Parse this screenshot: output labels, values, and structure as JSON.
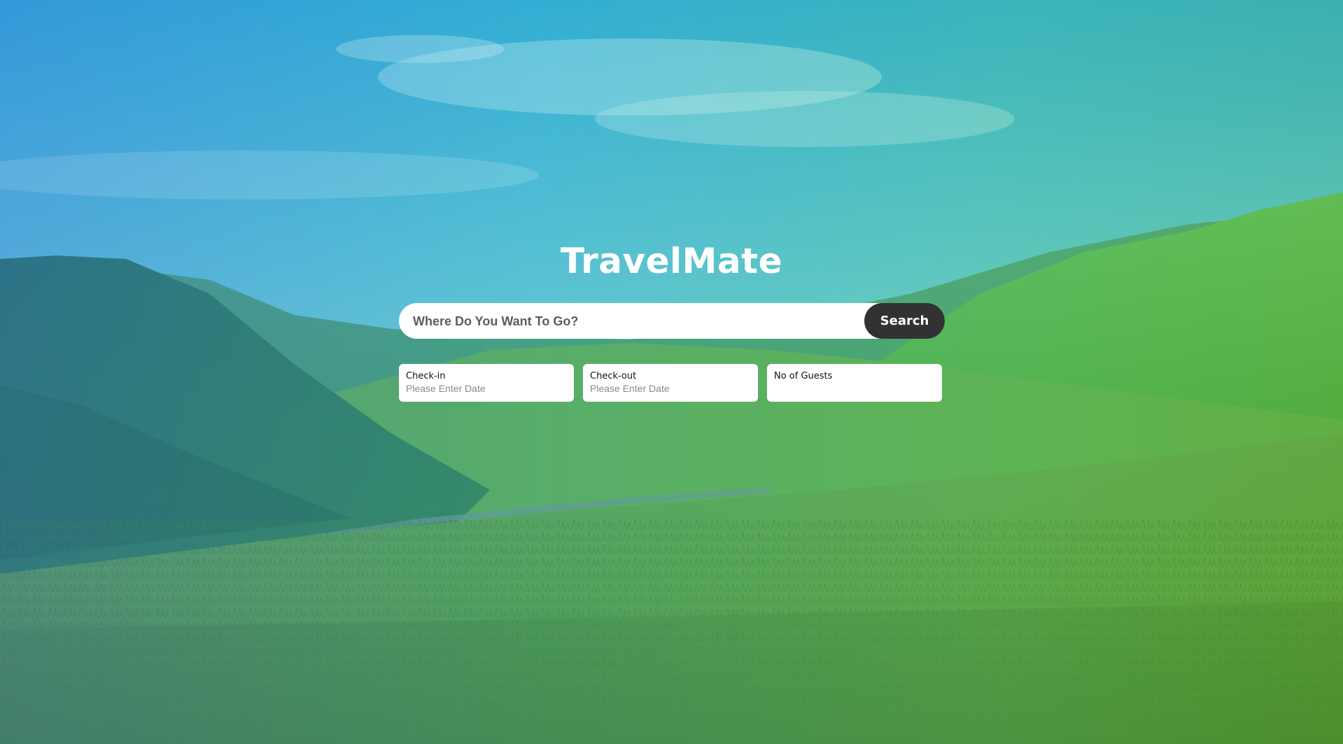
{
  "brand": {
    "title": "TravelMate"
  },
  "search": {
    "placeholder": "Where Do You Want To Go?",
    "button_label": "Search"
  },
  "fields": {
    "checkin": {
      "label": "Check-in",
      "placeholder": "Please Enter Date"
    },
    "checkout": {
      "label": "Check-out",
      "placeholder": "Please Enter Date"
    },
    "guests": {
      "label": "No of Guests",
      "placeholder": ""
    }
  },
  "colors": {
    "button_bg": "#343133",
    "brand_text": "#ffffff",
    "overlay_left": "#2882dc",
    "overlay_right": "#3cc83c"
  },
  "background": {
    "scene": "landscape-mountains-grassland"
  }
}
